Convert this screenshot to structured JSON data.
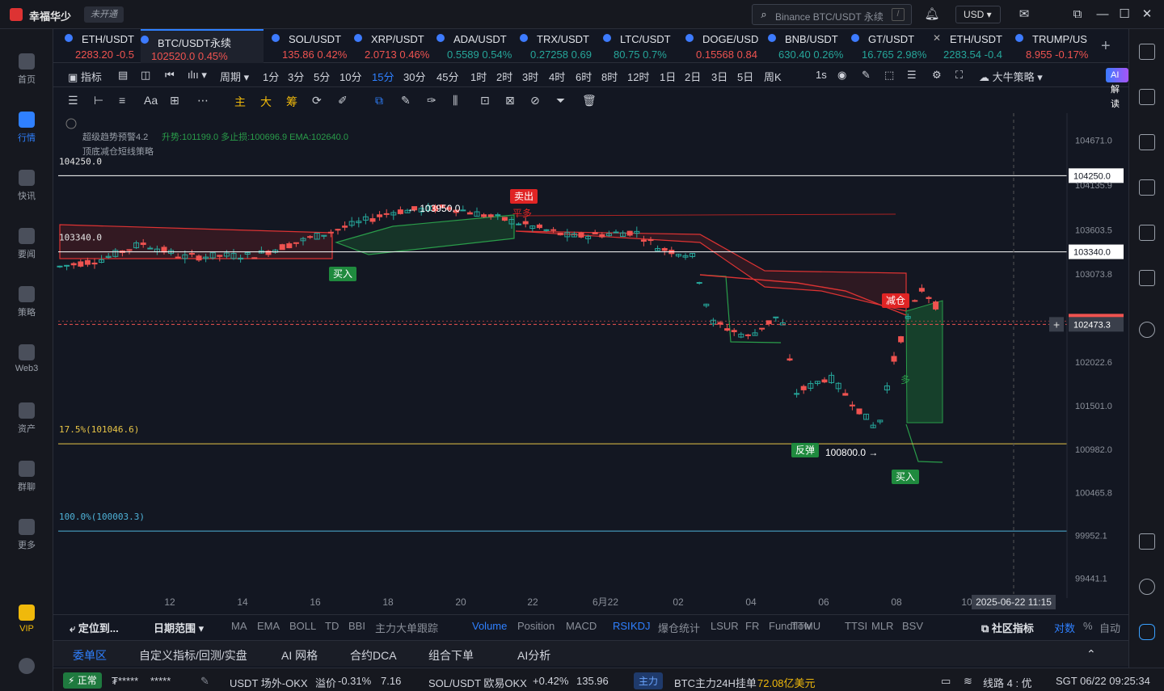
{
  "app": {
    "name": "幸福华少",
    "badge": "未开通",
    "search_placeholder": "Binance BTC/USDT 永续",
    "search_shortcut": "/",
    "currency": "USD"
  },
  "nav": [
    {
      "label": "首页"
    },
    {
      "label": "行情"
    },
    {
      "label": "快讯"
    },
    {
      "label": "要闻"
    },
    {
      "label": "策略"
    },
    {
      "label": "Web3"
    },
    {
      "label": "资产"
    },
    {
      "label": "群聊"
    },
    {
      "label": "更多"
    },
    {
      "label": "VIP"
    }
  ],
  "tickers": [
    {
      "name": "ETH/USDT",
      "price": "2283.20",
      "change": "-0.5",
      "dir": "dn"
    },
    {
      "name": "BTC/USDT永续",
      "price": "102520.0",
      "change": "0.45%",
      "dir": "dn"
    },
    {
      "name": "SOL/USDT",
      "price": "135.86",
      "change": "0.42%",
      "dir": "dn"
    },
    {
      "name": "XRP/USDT",
      "price": "2.0713",
      "change": "0.46%",
      "dir": "dn"
    },
    {
      "name": "ADA/USDT",
      "price": "0.5589",
      "change": "0.54%",
      "dir": "up"
    },
    {
      "name": "TRX/USDT",
      "price": "0.27258",
      "change": "0.69",
      "dir": "up"
    },
    {
      "name": "LTC/USDT",
      "price": "80.75",
      "change": "0.7%",
      "dir": "up"
    },
    {
      "name": "DOGE/USD",
      "price": "0.15568",
      "change": "0.84",
      "dir": "dn"
    },
    {
      "name": "BNB/USDT",
      "price": "630.40",
      "change": "0.26%",
      "dir": "up"
    },
    {
      "name": "GT/USDT",
      "price": "16.765",
      "change": "2.98%",
      "dir": "up"
    },
    {
      "name": "ETH/USDT",
      "price": "2283.54",
      "change": "-0.4",
      "dir": "up"
    },
    {
      "name": "TRUMP/US",
      "price": "8.955",
      "change": "-0.17%",
      "dir": "dn"
    }
  ],
  "toolbar": {
    "indicator_label": "指标",
    "period_label": "周期",
    "intervals": [
      "1分",
      "3分",
      "5分",
      "10分",
      "15分",
      "30分",
      "45分",
      "1时",
      "2时",
      "3时",
      "4时",
      "6时",
      "8时",
      "12时",
      "1日",
      "2日",
      "3日",
      "5日",
      "周K"
    ],
    "selected_interval": "15分",
    "seconds_label": "1s",
    "strategy_label": "大牛策略",
    "ai_label": "AI解读"
  },
  "drawing_tools": {
    "main": "主",
    "big": "大",
    "chip": "筹",
    "font": "Aa"
  },
  "chart": {
    "indicator_title": "超级趋势预警4.2",
    "indicator_values": "升势:101199.0  多止损:100696.9  EMA:102640.0",
    "strategy_name": "顶底减仓短线策略",
    "level_high": "104250.0",
    "level_mid": "103340.0",
    "fib_1": "17.5%(101046.6)",
    "fib_2": "100.0%(100003.3)",
    "peak_label": "← 103950.0",
    "low_label": "100800.0 →",
    "signals": {
      "sell": "卖出",
      "close_long": "平多",
      "buy1": "买入",
      "reduce": "减仓",
      "rebound": "反弹",
      "buy2": "买入",
      "long_tag": "多"
    },
    "current_price": "102473.3",
    "crosshair_time": "2025-06-22 11:15"
  },
  "chart_data": {
    "type": "candlestick",
    "y_axis": [
      "104671.0",
      "104135.9",
      "103603.5",
      "103073.8",
      "102022.6",
      "101501.0",
      "100982.0",
      "100465.8",
      "99952.1",
      "99441.1"
    ],
    "x_axis": [
      "12",
      "14",
      "16",
      "18",
      "20",
      "22",
      "6月22",
      "02",
      "04",
      "06",
      "08",
      "10"
    ],
    "ylim": [
      99300,
      104900
    ]
  },
  "indicators_bar": {
    "locate": "定位到...",
    "date_range": "日期范围",
    "items": [
      "MA",
      "EMA",
      "BOLL",
      "TD",
      "BBI",
      "主力大单跟踪"
    ],
    "subitems": [
      "Volume",
      "Position",
      "MACD",
      "RSI",
      "KDJ",
      "爆仓统计",
      "LSUR",
      "FR",
      "Fundflow",
      "TTMU",
      "TTSI",
      "MLR",
      "BSV"
    ],
    "community": "社区指标",
    "log_label": "对数",
    "pct_label": "%",
    "auto_label": "自动"
  },
  "bottom_tabs": [
    "委单区",
    "自定义指标/回测/实盘",
    "AI 网格",
    "合约DCA",
    "组合下单",
    "AI分析"
  ],
  "status": {
    "ok_label": "正常",
    "masked1": "₮*****",
    "masked2": "*****",
    "usdt_label": "USDT 场外-OKX",
    "premium_label": "溢价",
    "premium_value": "-0.31%",
    "premium_price": "7.16",
    "sol_label": "SOL/USDT 欧易OKX",
    "sol_change": "+0.42%",
    "sol_price": "135.96",
    "main_tag": "主力",
    "btc_flow": "BTC主力24H挂单",
    "btc_flow_value": "72.08亿美元",
    "line_label": "线路 4 : 优",
    "clock": "SGT 06/22 09:25:34"
  }
}
